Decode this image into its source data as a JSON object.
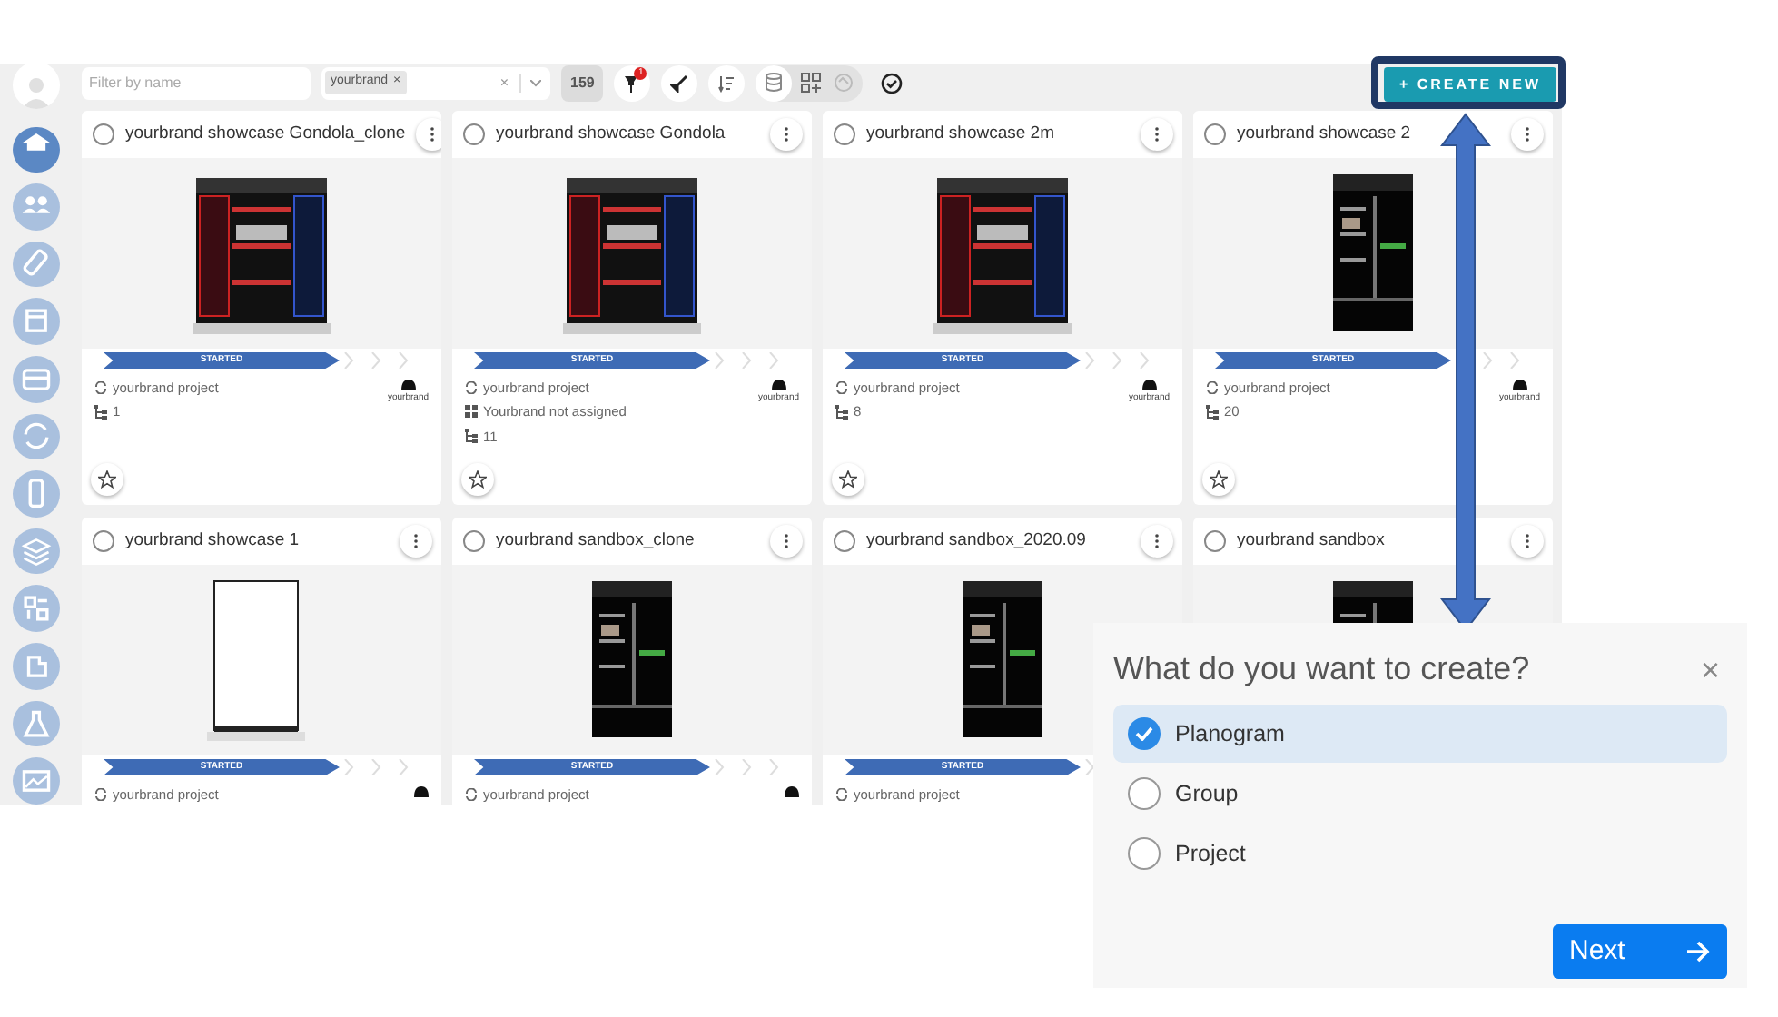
{
  "sidebar": {
    "items": [
      {
        "selected": true
      },
      {
        "selected": false
      },
      {
        "selected": false
      },
      {
        "selected": false
      },
      {
        "selected": false
      },
      {
        "selected": false
      },
      {
        "selected": false
      },
      {
        "selected": false
      },
      {
        "selected": false
      },
      {
        "selected": false
      },
      {
        "selected": false
      },
      {
        "selected": false
      }
    ]
  },
  "toolbar": {
    "filter": {
      "placeholder": "Filter by name"
    },
    "tag": {
      "label": "yourbrand",
      "remove": "×"
    },
    "clear": "×",
    "count": "159",
    "pin_badge": "1",
    "create_button": "+ CREATE NEW"
  },
  "cards": [
    {
      "title": "yourbrand showcase Gondola_clone",
      "selected": false,
      "status": "STARTED",
      "project": "yourbrand project",
      "count": "1",
      "logo": "yourbrand",
      "brand_mark": true,
      "starred": false
    },
    {
      "title": "yourbrand showcase Gondola",
      "selected": false,
      "status": "STARTED",
      "project": "yourbrand project",
      "assignment": "Yourbrand not assigned",
      "count": "11",
      "logo": "yourbrand",
      "brand_mark": true,
      "starred": false
    },
    {
      "title": "yourbrand showcase 2m",
      "selected": false,
      "status": "STARTED",
      "project": "yourbrand project",
      "count": "8",
      "logo": "yourbrand",
      "brand_mark": true,
      "starred": false
    },
    {
      "title": "yourbrand showcase 2",
      "selected": false,
      "status": "STARTED",
      "project": "yourbrand project",
      "count": "20",
      "logo": "yourbrand",
      "brand_mark": true,
      "starred": false
    },
    {
      "title": "yourbrand showcase 1",
      "selected": false,
      "status": "STARTED",
      "project": "yourbrand project",
      "brand_mark": true
    },
    {
      "title": "yourbrand sandbox_clone",
      "selected": false,
      "status": "STARTED",
      "project": "yourbrand project",
      "brand_mark": true
    },
    {
      "title": "yourbrand sandbox_2020.09",
      "selected": false,
      "status": "STARTED",
      "project": "yourbrand project"
    },
    {
      "title": "yourbrand sandbox",
      "selected": false
    }
  ],
  "dialog": {
    "title": "What do you want to create?",
    "close": "×",
    "options": [
      {
        "label": "Planogram",
        "selected": true
      },
      {
        "label": "Group",
        "selected": false
      },
      {
        "label": "Project",
        "selected": false
      }
    ],
    "next_button": "Next"
  }
}
